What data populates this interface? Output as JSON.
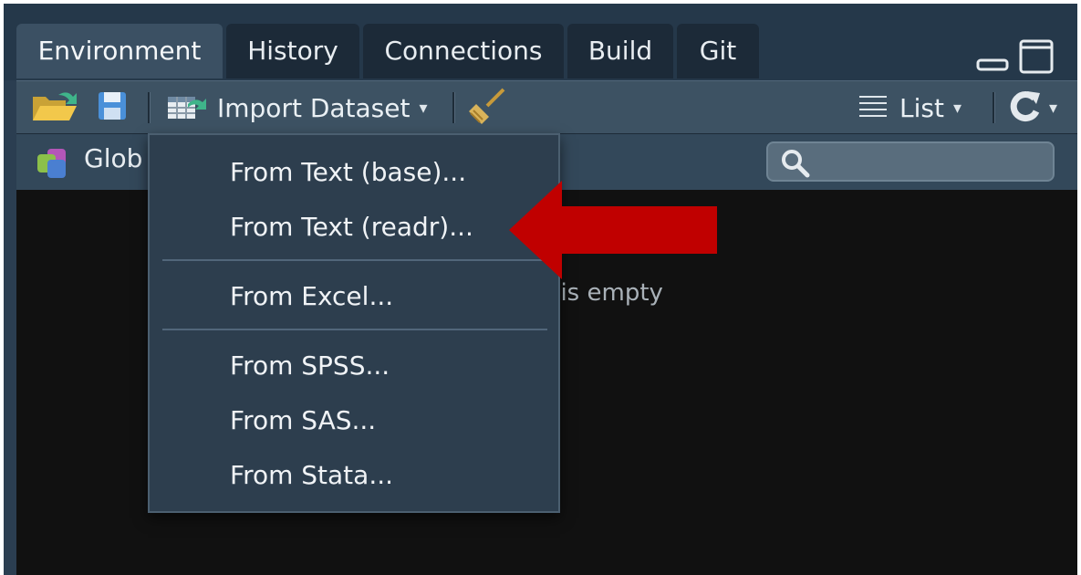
{
  "tabs": [
    {
      "label": "Environment",
      "active": true
    },
    {
      "label": "History",
      "active": false
    },
    {
      "label": "Connections",
      "active": false
    },
    {
      "label": "Build",
      "active": false
    },
    {
      "label": "Git",
      "active": false
    }
  ],
  "toolbar": {
    "open_icon": "folder-open-icon",
    "save_icon": "floppy-disk-icon",
    "import_label": "Import Dataset",
    "clear_icon": "broom-icon",
    "view_label": "List",
    "refresh_icon": "refresh-icon"
  },
  "environment_selector": {
    "label": "Global Environment",
    "visible_text": "Glob"
  },
  "search": {
    "placeholder": "",
    "icon": "search-icon"
  },
  "empty_message": "t is empty",
  "import_menu": {
    "groups": [
      [
        "From Text (base)...",
        "From Text (readr)..."
      ],
      [
        "From Excel..."
      ],
      [
        "From SPSS...",
        "From SAS...",
        "From Stata..."
      ]
    ],
    "items": [
      "From Text (base)...",
      "From Text (readr)...",
      "From Excel...",
      "From SPSS...",
      "From SAS...",
      "From Stata..."
    ],
    "highlighted_by_arrow": "From Text (readr)..."
  },
  "colors": {
    "pane_bg": "#2b3e51",
    "content_bg": "#111111",
    "menu_bg": "#2d3e4e",
    "arrow": "#c00000",
    "text": "#f0f3f6"
  }
}
